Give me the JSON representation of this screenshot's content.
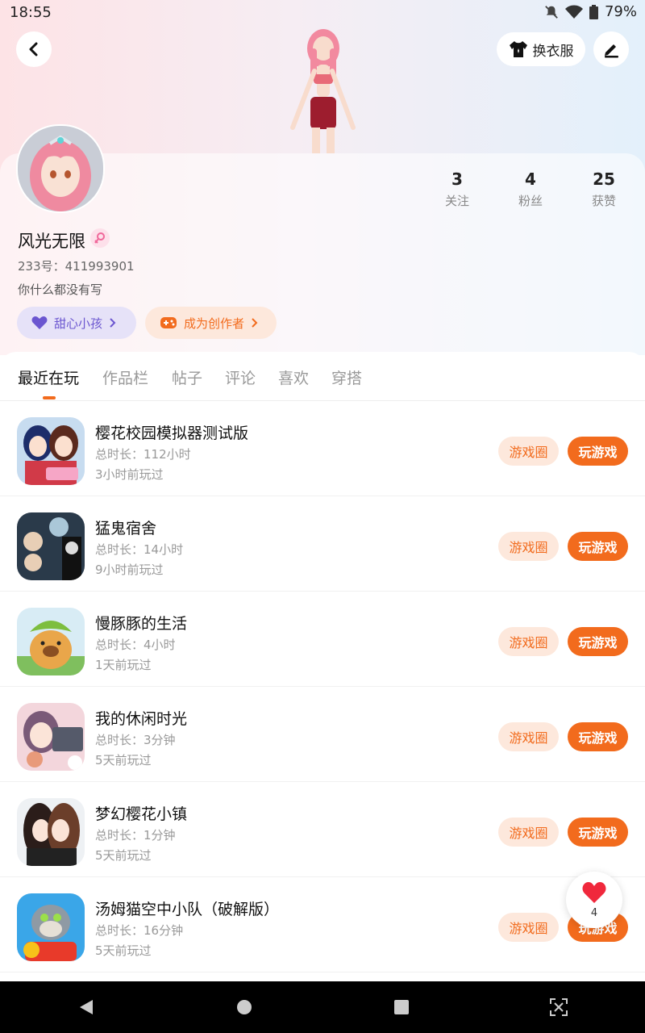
{
  "status_bar": {
    "time": "18:55",
    "battery": "79%"
  },
  "header": {
    "dress_label": "换衣服"
  },
  "profile": {
    "name": "风光无限",
    "id_label": "233号：",
    "id_value": "411993901",
    "bio": "你什么都没有写",
    "stats": [
      {
        "num": "3",
        "label": "关注"
      },
      {
        "num": "4",
        "label": "粉丝"
      },
      {
        "num": "25",
        "label": "获赞"
      }
    ],
    "badges": {
      "sweet": "甜心小孩",
      "creator": "成为创作者"
    }
  },
  "tabs": [
    "最近在玩",
    "作品栏",
    "帖子",
    "评论",
    "喜欢",
    "穿搭"
  ],
  "games": [
    {
      "name": "樱花校园模拟器测试版",
      "duration": "总时长：112小时",
      "last": "3小时前玩过"
    },
    {
      "name": "猛鬼宿舍",
      "duration": "总时长：14小时",
      "last": "9小时前玩过"
    },
    {
      "name": "慢豚豚的生活",
      "duration": "总时长：4小时",
      "last": "1天前玩过"
    },
    {
      "name": "我的休闲时光",
      "duration": "总时长：3分钟",
      "last": "5天前玩过"
    },
    {
      "name": "梦幻樱花小镇",
      "duration": "总时长：1分钟",
      "last": "5天前玩过"
    },
    {
      "name": "汤姆猫空中小队（破解版）",
      "duration": "总时长：16分钟",
      "last": "5天前玩过"
    }
  ],
  "buttons": {
    "circle": "游戏圈",
    "play": "玩游戏"
  },
  "like_count": "4",
  "colors": {
    "accent": "#f26b1d",
    "accent_light": "#fde8dc",
    "purple": "#6b56d0"
  },
  "icons": [
    "back-icon",
    "tshirt-icon",
    "edit-icon",
    "female-icon",
    "heart-icon",
    "gamepad-icon",
    "chevron-right-icon"
  ]
}
